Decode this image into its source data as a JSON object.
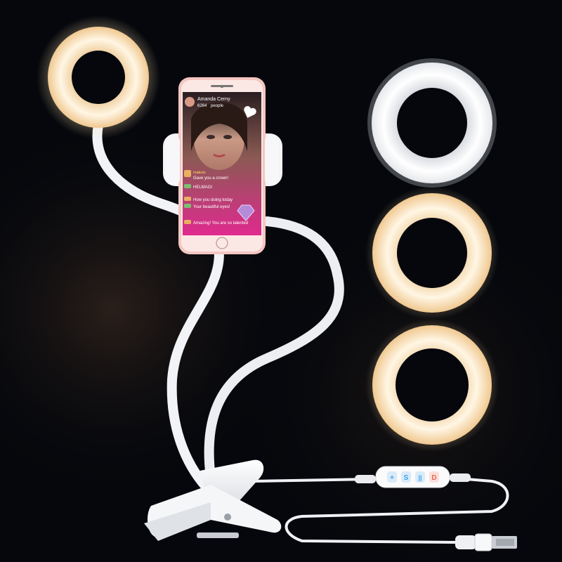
{
  "phone": {
    "streamer_name": "Amanda Cerny",
    "viewer_count": "6264",
    "viewer_label": "people",
    "chat": [
      {
        "user": "makulu",
        "message": "Gave you a crown!"
      },
      {
        "user": "",
        "message": "HELMAGI"
      },
      {
        "user": "",
        "message": "How you doing today"
      },
      {
        "user": "",
        "message": "Your beautiful eyes!"
      },
      {
        "user": "",
        "message": "Amazing! You are so talented"
      }
    ]
  },
  "controller": {
    "buttons": [
      {
        "symbol": "+",
        "color": "#3fa0e8"
      },
      {
        "symbol": "S",
        "color": "#3fa0e8"
      },
      {
        "symbol": "||",
        "color": "#3fa0e8"
      },
      {
        "symbol": "D",
        "color": "#e86a5a"
      }
    ]
  },
  "colors": {
    "background": "#05070c",
    "warm_light": "#fff3dc",
    "warm_glow": "#f0c890",
    "cool_light": "#ffffff",
    "phone_body": "#f4c6c2",
    "stream_pink": "#e02a8f"
  }
}
